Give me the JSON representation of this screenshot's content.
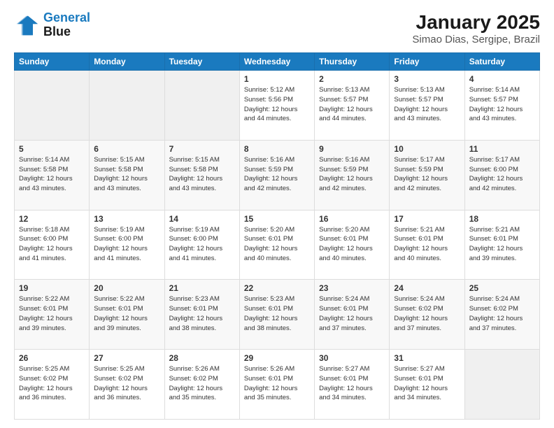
{
  "header": {
    "logo_line1": "General",
    "logo_line2": "Blue",
    "title": "January 2025",
    "subtitle": "Simao Dias, Sergipe, Brazil"
  },
  "days_of_week": [
    "Sunday",
    "Monday",
    "Tuesday",
    "Wednesday",
    "Thursday",
    "Friday",
    "Saturday"
  ],
  "weeks": [
    [
      {
        "day": "",
        "info": ""
      },
      {
        "day": "",
        "info": ""
      },
      {
        "day": "",
        "info": ""
      },
      {
        "day": "1",
        "info": "Sunrise: 5:12 AM\nSunset: 5:56 PM\nDaylight: 12 hours\nand 44 minutes."
      },
      {
        "day": "2",
        "info": "Sunrise: 5:13 AM\nSunset: 5:57 PM\nDaylight: 12 hours\nand 44 minutes."
      },
      {
        "day": "3",
        "info": "Sunrise: 5:13 AM\nSunset: 5:57 PM\nDaylight: 12 hours\nand 43 minutes."
      },
      {
        "day": "4",
        "info": "Sunrise: 5:14 AM\nSunset: 5:57 PM\nDaylight: 12 hours\nand 43 minutes."
      }
    ],
    [
      {
        "day": "5",
        "info": "Sunrise: 5:14 AM\nSunset: 5:58 PM\nDaylight: 12 hours\nand 43 minutes."
      },
      {
        "day": "6",
        "info": "Sunrise: 5:15 AM\nSunset: 5:58 PM\nDaylight: 12 hours\nand 43 minutes."
      },
      {
        "day": "7",
        "info": "Sunrise: 5:15 AM\nSunset: 5:58 PM\nDaylight: 12 hours\nand 43 minutes."
      },
      {
        "day": "8",
        "info": "Sunrise: 5:16 AM\nSunset: 5:59 PM\nDaylight: 12 hours\nand 42 minutes."
      },
      {
        "day": "9",
        "info": "Sunrise: 5:16 AM\nSunset: 5:59 PM\nDaylight: 12 hours\nand 42 minutes."
      },
      {
        "day": "10",
        "info": "Sunrise: 5:17 AM\nSunset: 5:59 PM\nDaylight: 12 hours\nand 42 minutes."
      },
      {
        "day": "11",
        "info": "Sunrise: 5:17 AM\nSunset: 6:00 PM\nDaylight: 12 hours\nand 42 minutes."
      }
    ],
    [
      {
        "day": "12",
        "info": "Sunrise: 5:18 AM\nSunset: 6:00 PM\nDaylight: 12 hours\nand 41 minutes."
      },
      {
        "day": "13",
        "info": "Sunrise: 5:19 AM\nSunset: 6:00 PM\nDaylight: 12 hours\nand 41 minutes."
      },
      {
        "day": "14",
        "info": "Sunrise: 5:19 AM\nSunset: 6:00 PM\nDaylight: 12 hours\nand 41 minutes."
      },
      {
        "day": "15",
        "info": "Sunrise: 5:20 AM\nSunset: 6:01 PM\nDaylight: 12 hours\nand 40 minutes."
      },
      {
        "day": "16",
        "info": "Sunrise: 5:20 AM\nSunset: 6:01 PM\nDaylight: 12 hours\nand 40 minutes."
      },
      {
        "day": "17",
        "info": "Sunrise: 5:21 AM\nSunset: 6:01 PM\nDaylight: 12 hours\nand 40 minutes."
      },
      {
        "day": "18",
        "info": "Sunrise: 5:21 AM\nSunset: 6:01 PM\nDaylight: 12 hours\nand 39 minutes."
      }
    ],
    [
      {
        "day": "19",
        "info": "Sunrise: 5:22 AM\nSunset: 6:01 PM\nDaylight: 12 hours\nand 39 minutes."
      },
      {
        "day": "20",
        "info": "Sunrise: 5:22 AM\nSunset: 6:01 PM\nDaylight: 12 hours\nand 39 minutes."
      },
      {
        "day": "21",
        "info": "Sunrise: 5:23 AM\nSunset: 6:01 PM\nDaylight: 12 hours\nand 38 minutes."
      },
      {
        "day": "22",
        "info": "Sunrise: 5:23 AM\nSunset: 6:01 PM\nDaylight: 12 hours\nand 38 minutes."
      },
      {
        "day": "23",
        "info": "Sunrise: 5:24 AM\nSunset: 6:01 PM\nDaylight: 12 hours\nand 37 minutes."
      },
      {
        "day": "24",
        "info": "Sunrise: 5:24 AM\nSunset: 6:02 PM\nDaylight: 12 hours\nand 37 minutes."
      },
      {
        "day": "25",
        "info": "Sunrise: 5:24 AM\nSunset: 6:02 PM\nDaylight: 12 hours\nand 37 minutes."
      }
    ],
    [
      {
        "day": "26",
        "info": "Sunrise: 5:25 AM\nSunset: 6:02 PM\nDaylight: 12 hours\nand 36 minutes."
      },
      {
        "day": "27",
        "info": "Sunrise: 5:25 AM\nSunset: 6:02 PM\nDaylight: 12 hours\nand 36 minutes."
      },
      {
        "day": "28",
        "info": "Sunrise: 5:26 AM\nSunset: 6:02 PM\nDaylight: 12 hours\nand 35 minutes."
      },
      {
        "day": "29",
        "info": "Sunrise: 5:26 AM\nSunset: 6:01 PM\nDaylight: 12 hours\nand 35 minutes."
      },
      {
        "day": "30",
        "info": "Sunrise: 5:27 AM\nSunset: 6:01 PM\nDaylight: 12 hours\nand 34 minutes."
      },
      {
        "day": "31",
        "info": "Sunrise: 5:27 AM\nSunset: 6:01 PM\nDaylight: 12 hours\nand 34 minutes."
      },
      {
        "day": "",
        "info": ""
      }
    ]
  ]
}
